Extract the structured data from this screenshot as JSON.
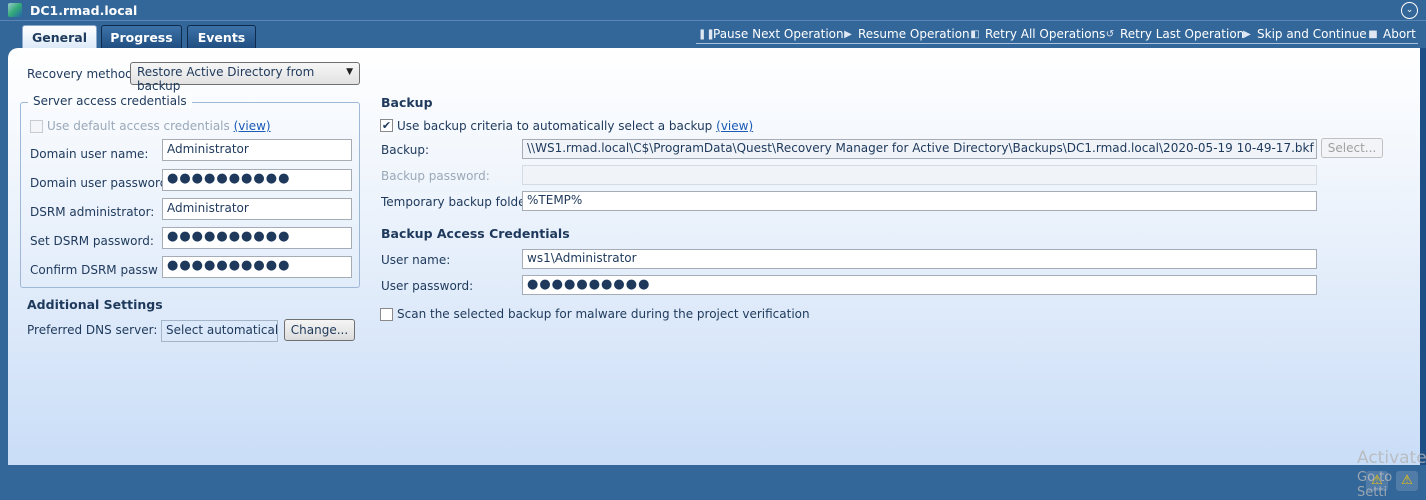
{
  "window": {
    "title": "DC1.rmad.local"
  },
  "tabs": [
    {
      "label": "General"
    },
    {
      "label": "Progress"
    },
    {
      "label": "Events"
    }
  ],
  "toolbar": [
    {
      "label": "Pause Next Operation",
      "icon": "pause-icon"
    },
    {
      "label": "Resume Operation",
      "icon": "play-icon"
    },
    {
      "label": "Retry All Operations",
      "icon": "retry-all-icon"
    },
    {
      "label": "Retry Last Operation",
      "icon": "retry-icon"
    },
    {
      "label": "Skip and Continue",
      "icon": "skip-icon"
    },
    {
      "label": "Abort",
      "icon": "stop-icon"
    }
  ],
  "recovery": {
    "label": "Recovery method:",
    "value": "Restore Active Directory from backup"
  },
  "server": {
    "legend": "Server access credentials",
    "use_default": "Use default access credentials",
    "view": "(view)",
    "domain_user_label": "Domain user name:",
    "domain_user": "Administrator",
    "domain_pw_label": "Domain user password:",
    "domain_pw": "●●●●●●●●●●",
    "dsrm_admin_label": "DSRM administrator:",
    "dsrm_admin": "Administrator",
    "set_dsrm_label": "Set DSRM password:",
    "set_dsrm": "●●●●●●●●●●",
    "confirm_dsrm_label": "Confirm DSRM passwor",
    "confirm_dsrm": "●●●●●●●●●●"
  },
  "additional": {
    "heading": "Additional Settings",
    "dns_label": "Preferred DNS server:",
    "dns_value": "Select automatically",
    "change": "Change..."
  },
  "backup": {
    "heading": "Backup",
    "use_criteria": "Use backup criteria to automatically select a backup",
    "view": "(view)",
    "use_criteria_checked": true,
    "backup_label": "Backup:",
    "backup_path": "\\\\WS1.rmad.local\\C$\\ProgramData\\Quest\\Recovery Manager for Active Directory\\Backups\\DC1.rmad.local\\2020-05-19 10-49-17.bkf",
    "select": "Select...",
    "pw_label": "Backup password:",
    "pw": "",
    "temp_label": "Temporary backup folder:",
    "temp": "%TEMP%",
    "cred_heading": "Backup Access Credentials",
    "user_label": "User name:",
    "user": "ws1\\Administrator",
    "upw_label": "User password:",
    "upw": "●●●●●●●●●●",
    "scan": "Scan the selected backup for malware during the project verification"
  },
  "watermark": {
    "line1": "Activate",
    "line2": "Go to Setti"
  }
}
